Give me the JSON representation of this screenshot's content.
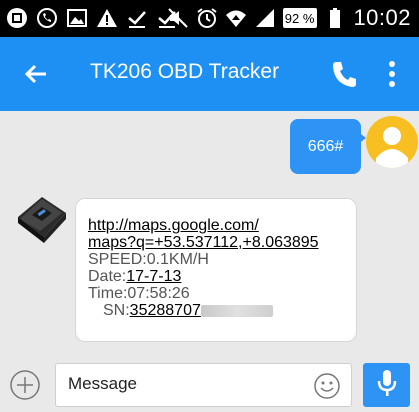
{
  "status_bar": {
    "battery": "92 %",
    "time": "10:02"
  },
  "app_bar": {
    "title": "TK206 OBD Tracker"
  },
  "messages": {
    "outgoing": {
      "text": "666#"
    },
    "incoming": {
      "link_line1": "http://maps.google.com/",
      "link_line2": "maps?q=+53.537112,+8.063895",
      "speed": "SPEED:0.1KM/H",
      "date_label": "Date:",
      "date_value": "17-7-13",
      "time": "Time:07:58:26",
      "sn_label": "SN:",
      "sn_value": "35288707"
    }
  },
  "composer": {
    "placeholder": "Message"
  },
  "colors": {
    "app_bar": "#1e90f4",
    "outgoing_bubble": "#2d93f5",
    "avatar": "#f8bf22",
    "background": "#e9e9e9"
  }
}
